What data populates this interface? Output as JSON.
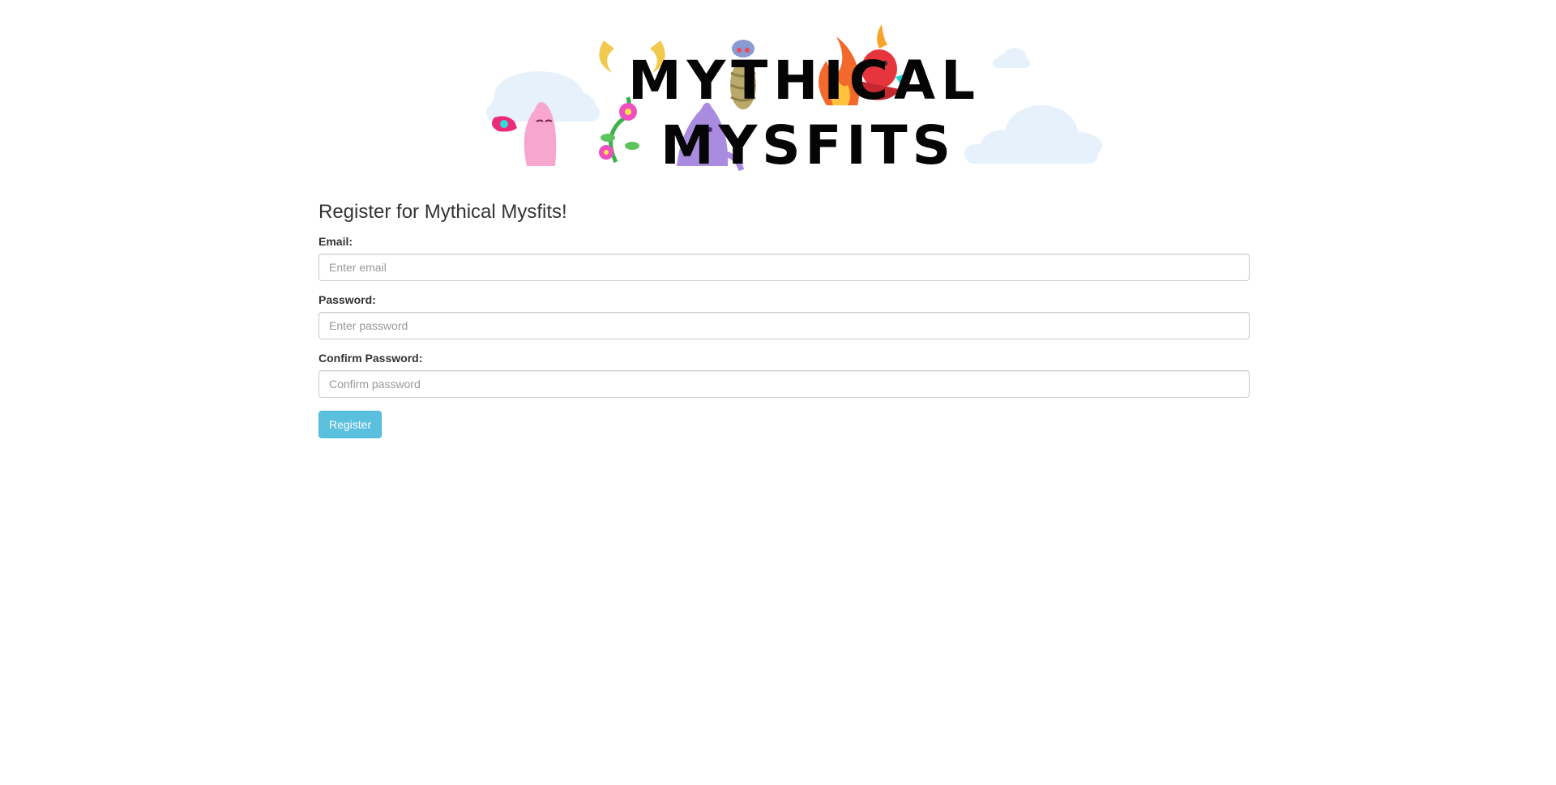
{
  "banner": {
    "line1": "MYTHICAL",
    "line2": "MYSFITS",
    "cloud_color": "#e6f1fc",
    "logo_color": "#050505"
  },
  "form": {
    "title": "Register for Mythical Mysfits!",
    "email_label": "Email:",
    "email_placeholder": "Enter email",
    "email_value": "",
    "password_label": "Password:",
    "password_placeholder": "Enter password",
    "password_value": "",
    "confirm_label": "Confirm Password:",
    "confirm_placeholder": "Confirm password",
    "confirm_value": "",
    "submit_label": "Register",
    "accent_color": "#5bc0de"
  }
}
